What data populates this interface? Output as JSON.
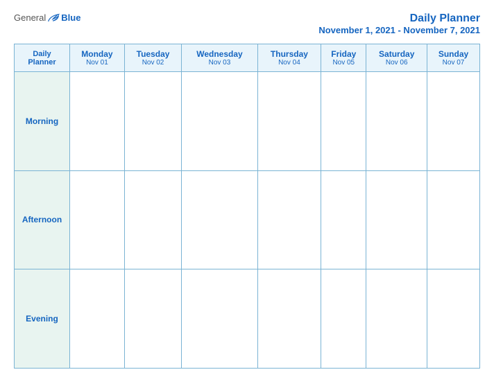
{
  "header": {
    "logo": {
      "general": "General",
      "blue": "Blue"
    },
    "title": "Daily Planner",
    "date_range": "November 1, 2021 - November 7, 2021"
  },
  "table": {
    "label_header": {
      "line1": "Daily",
      "line2": "Planner"
    },
    "columns": [
      {
        "day": "Monday",
        "date": "Nov 01"
      },
      {
        "day": "Tuesday",
        "date": "Nov 02"
      },
      {
        "day": "Wednesday",
        "date": "Nov 03"
      },
      {
        "day": "Thursday",
        "date": "Nov 04"
      },
      {
        "day": "Friday",
        "date": "Nov 05"
      },
      {
        "day": "Saturday",
        "date": "Nov 06"
      },
      {
        "day": "Sunday",
        "date": "Nov 07"
      }
    ],
    "rows": [
      {
        "label": "Morning"
      },
      {
        "label": "Afternoon"
      },
      {
        "label": "Evening"
      }
    ]
  }
}
